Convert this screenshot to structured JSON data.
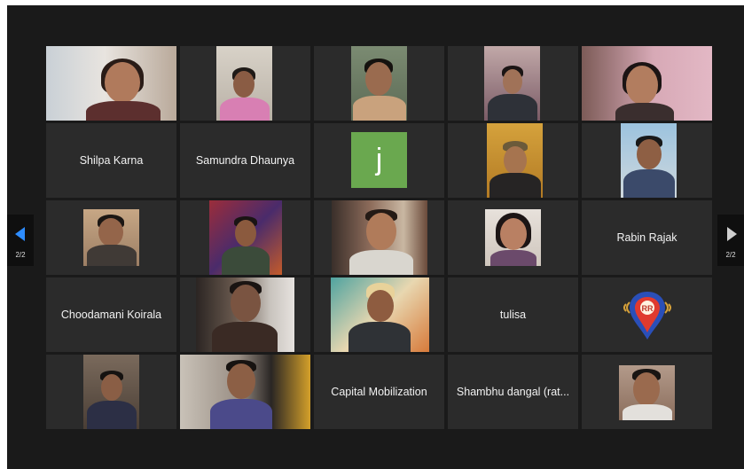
{
  "gallery": {
    "page_indicator_left": "2/2",
    "page_indicator_right": "2/2",
    "tiles": {
      "shilpa": "Shilpa Karna",
      "samundra": "Samundra Dhaunya",
      "j_avatar": "j",
      "rabin": "Rabin Rajak",
      "choodamani": "Choodamani Koirala",
      "tulisa": "tulisa",
      "capital": "Capital Mobilization",
      "shambhu": "Shambhu dangal (rat..."
    }
  },
  "colors": {
    "background": "#1a1a1a",
    "tile": "#2b2b2b",
    "arrow_left": "#2d8cff",
    "avatar_j": "#6aa84f"
  }
}
